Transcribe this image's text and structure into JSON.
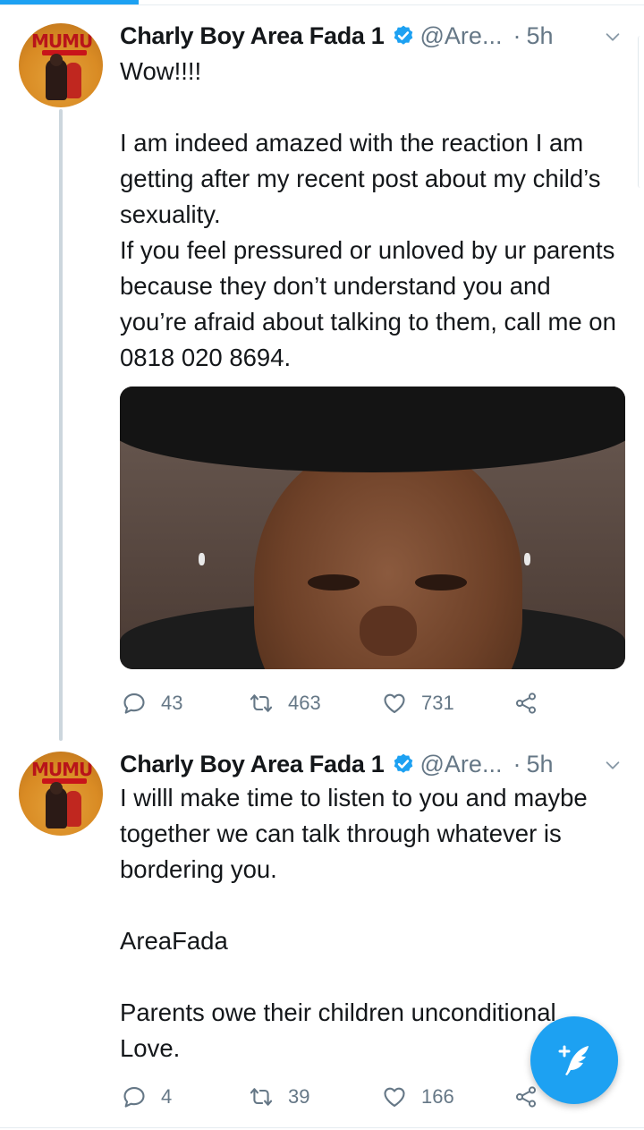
{
  "accent_color": "#1da1f2",
  "text_color": "#14171a",
  "secondary_color": "#657786",
  "tweets": [
    {
      "author": {
        "name": "Charly Boy Area Fada 1",
        "handle": "@Are...",
        "verified": true,
        "avatar_text": "MUMU"
      },
      "time": "5h",
      "time_separator": "·",
      "text_paragraphs": [
        "Wow!!!!",
        "",
        "I am indeed amazed with the reaction I am getting after my recent post about my child’s sexuality.",
        "If you feel pressured or unloved by ur parents because they don’t understand you and you’re afraid about talking to them, call me on 0818 020 8694."
      ],
      "has_photo": true,
      "stats": {
        "replies": "43",
        "retweets": "463",
        "likes": "731"
      }
    },
    {
      "author": {
        "name": "Charly Boy Area Fada 1",
        "handle": "@Are...",
        "verified": true,
        "avatar_text": "MUMU"
      },
      "time": "5h",
      "time_separator": "·",
      "text_paragraphs": [
        "I willl make time to listen to you and maybe together we can talk through whatever is bordering you.",
        "",
        "AreaFada",
        "",
        "Parents owe their children unconditional Love."
      ],
      "has_photo": false,
      "stats": {
        "replies": "4",
        "retweets": "39",
        "likes": "166"
      }
    }
  ],
  "icons": {
    "reply": "reply-icon",
    "retweet": "retweet-icon",
    "like": "heart-icon",
    "share": "share-icon",
    "more": "chevron-down-icon",
    "verified": "verified-badge-icon",
    "compose": "compose-tweet-icon"
  }
}
